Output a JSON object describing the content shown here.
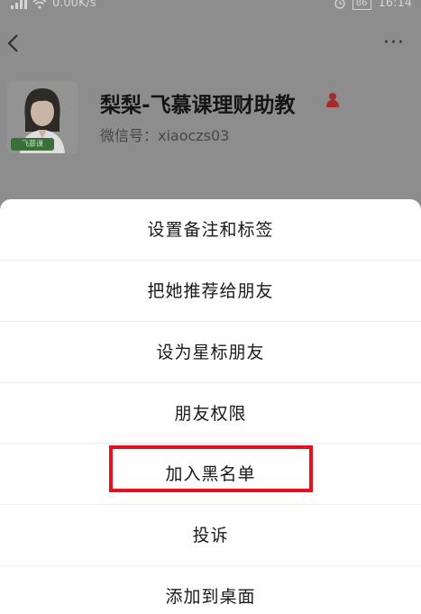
{
  "status_bar": {
    "network_speed": "0.00K/s",
    "battery_level": "86",
    "time": "16:14",
    "icons": [
      "signal-icon",
      "wifi-icon",
      "alarm-icon",
      "battery-icon"
    ]
  },
  "nav": {
    "back_icon": "chevron-left-icon",
    "more_label": "···"
  },
  "profile": {
    "avatar_strip_text": "飞慕课",
    "display_name": "梨梨-飞慕课理财助教",
    "gender_icon": "person-icon",
    "wechat_id": "微信号：xiaoczs03"
  },
  "action_sheet": {
    "items": [
      {
        "label": "设置备注和标签"
      },
      {
        "label": "把她推荐给朋友"
      },
      {
        "label": "设为星标朋友"
      },
      {
        "label": "朋友权限"
      },
      {
        "label": "加入黑名单"
      },
      {
        "label": "投诉"
      },
      {
        "label": "添加到桌面"
      }
    ],
    "highlighted_item": "加入黑名单"
  },
  "colors": {
    "overlay_background": "#8d8d8d",
    "sheet_background": "#ffffff",
    "highlight_border": "#e5121d",
    "avatar_strip": "#3a6e3a"
  }
}
